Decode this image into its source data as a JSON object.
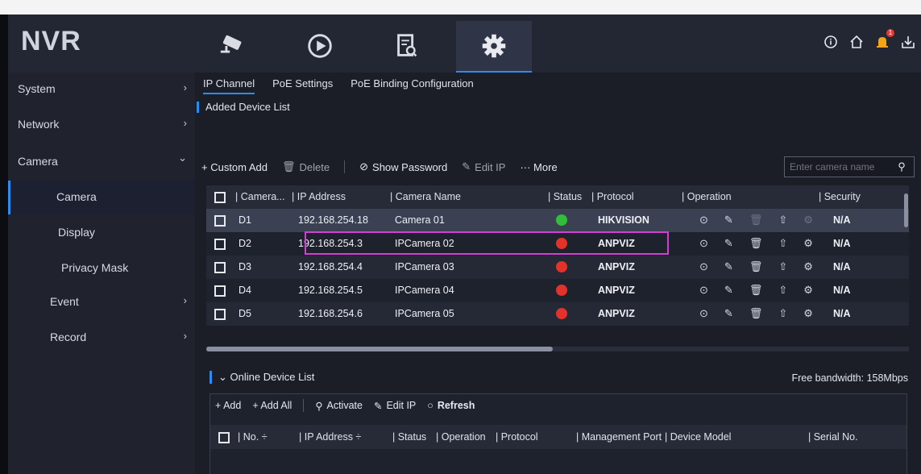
{
  "app": {
    "logo": "NVR"
  },
  "top_nav": [
    {
      "icon": "camera-icon",
      "active": false
    },
    {
      "icon": "playback-icon",
      "active": false
    },
    {
      "icon": "search-file-icon",
      "active": false
    },
    {
      "icon": "gear-icon",
      "active": true
    }
  ],
  "top_right": {
    "notification_count": "1"
  },
  "sidebar": {
    "items": [
      {
        "label": "System",
        "chevron": "›"
      },
      {
        "label": "Network",
        "chevron": "›"
      },
      {
        "label": "Camera",
        "chevron": "⌄"
      },
      {
        "label": "Camera",
        "chevron": ""
      },
      {
        "label": "Display",
        "chevron": ""
      },
      {
        "label": "Privacy Mask",
        "chevron": ""
      },
      {
        "label": "Event",
        "chevron": "›"
      },
      {
        "label": "Record",
        "chevron": "›"
      }
    ]
  },
  "tabs": [
    "IP Channel",
    "PoE Settings",
    "PoE Binding Configuration"
  ],
  "added": {
    "title": "Added Device List",
    "toolbar": {
      "custom_add": "+ Custom Add",
      "delete": "Delete",
      "show_password": "Show Password",
      "edit_ip": "Edit IP",
      "more": "··· More"
    },
    "search_placeholder": "Enter camera name",
    "headers": {
      "camera": "| Camera...",
      "ip": "| IP Address",
      "name": "| Camera Name",
      "status": "| Status",
      "protocol": "| Protocol",
      "operation": "| Operation",
      "security": "| Security"
    },
    "rows": [
      {
        "camera": "D1",
        "ip": "192.168.254.18",
        "name": "Camera 01",
        "status": "online",
        "protocol": "HIKVISION",
        "security": "N/A"
      },
      {
        "camera": "D2",
        "ip": "192.168.254.3",
        "name": "IPCamera 02",
        "status": "offline",
        "protocol": "ANPVIZ",
        "security": "N/A"
      },
      {
        "camera": "D3",
        "ip": "192.168.254.4",
        "name": "IPCamera 03",
        "status": "offline",
        "protocol": "ANPVIZ",
        "security": "N/A"
      },
      {
        "camera": "D4",
        "ip": "192.168.254.5",
        "name": "IPCamera 04",
        "status": "offline",
        "protocol": "ANPVIZ",
        "security": "N/A"
      },
      {
        "camera": "D5",
        "ip": "192.168.254.6",
        "name": "IPCamera 05",
        "status": "offline",
        "protocol": "ANPVIZ",
        "security": "N/A"
      }
    ]
  },
  "online": {
    "title": "Online Device List",
    "bandwidth": "Free bandwidth: 158Mbps",
    "toolbar": {
      "add": "+ Add",
      "add_all": "+ Add All",
      "activate": "Activate",
      "edit_ip": "Edit IP",
      "refresh": "Refresh"
    },
    "headers": {
      "no": "| No. ÷",
      "ip": "| IP Address ÷",
      "status": "| Status",
      "operation": "| Operation",
      "protocol": "| Protocol",
      "mgmt_port": "| Management Port",
      "model": "| Device Model",
      "serial": "| Serial No."
    }
  },
  "colors": {
    "accent": "#2d8cf0",
    "online": "#2fbf3a",
    "offline": "#e3312b",
    "highlight": "#d23fd2"
  }
}
